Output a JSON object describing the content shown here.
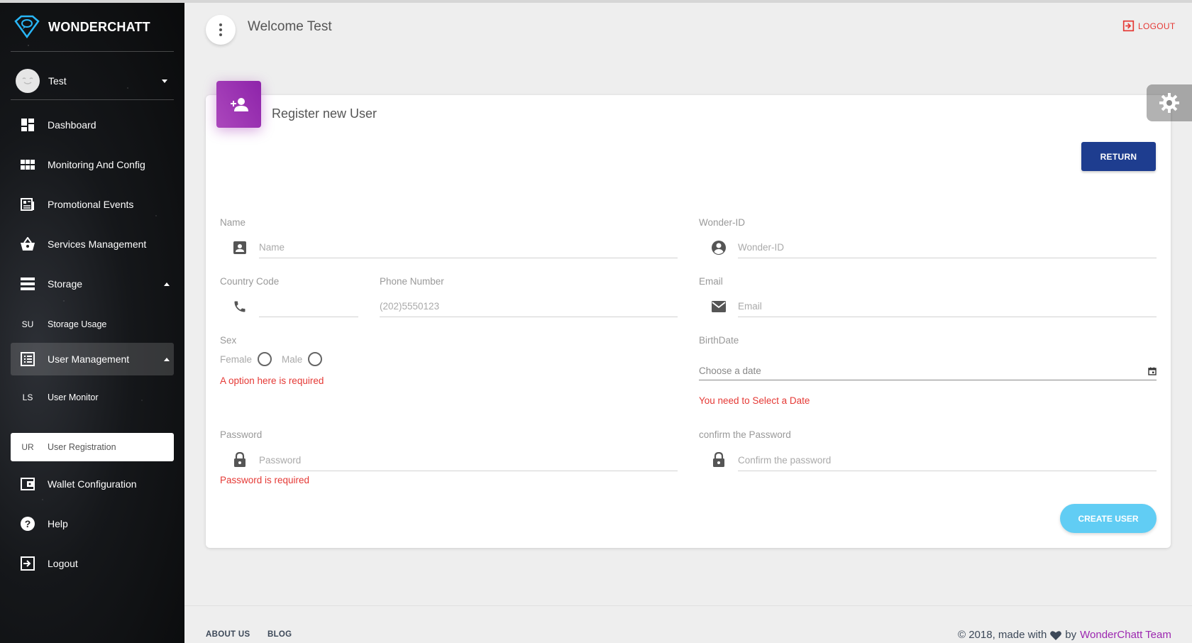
{
  "brand": {
    "name": "WONDERCHATT"
  },
  "user": {
    "name": "Test"
  },
  "sidebar": {
    "items": [
      {
        "label": "Dashboard",
        "icon": "dashboard-icon"
      },
      {
        "label": "Monitoring And Config",
        "icon": "grid-icon"
      },
      {
        "label": "Promotional Events",
        "icon": "newspaper-icon"
      },
      {
        "label": "Services Management",
        "icon": "basket-icon"
      },
      {
        "label": "Storage",
        "icon": "storage-icon",
        "expanded": true
      },
      {
        "abbr": "SU",
        "label": "Storage Usage"
      },
      {
        "label": "User Management",
        "icon": "list-icon",
        "expanded": true
      },
      {
        "abbr": "LS",
        "label": "User Monitor"
      },
      {
        "abbr": "UR",
        "label": "User Registration",
        "active": true
      },
      {
        "label": "Wallet Configuration",
        "icon": "wallet-icon"
      },
      {
        "label": "Help",
        "icon": "help-icon"
      },
      {
        "label": "Logout",
        "icon": "exit-icon"
      }
    ]
  },
  "header": {
    "welcome": "Welcome Test",
    "logout_label": "LOGOUT"
  },
  "card": {
    "title": "Register new User",
    "return_label": "RETURN",
    "create_label": "CREATE USER",
    "accent_color": "#9c27b0"
  },
  "form": {
    "name": {
      "label": "Name",
      "placeholder": "Name"
    },
    "wonder_id": {
      "label": "Wonder-ID",
      "placeholder": "Wonder-ID"
    },
    "country_code": {
      "label": "Country Code",
      "value": ""
    },
    "phone": {
      "label": "Phone Number",
      "placeholder": "(202)5550123"
    },
    "email": {
      "label": "Email",
      "placeholder": "Email"
    },
    "sex": {
      "label": "Sex",
      "options": [
        "Female",
        "Male"
      ],
      "error": "A option here is required"
    },
    "birthdate": {
      "label": "BirthDate",
      "placeholder": "Choose a date",
      "error": "You need to Select a Date"
    },
    "password": {
      "label": "Password",
      "placeholder": "Password",
      "error": "Password is required"
    },
    "confirm_password": {
      "label": "confirm the Password",
      "placeholder": "Confirm the password"
    }
  },
  "footer": {
    "links": [
      "ABOUT US",
      "BLOG"
    ],
    "copyright_prefix": "© 2018, made with",
    "copyright_by": "by",
    "team": "WonderChatt Team"
  }
}
